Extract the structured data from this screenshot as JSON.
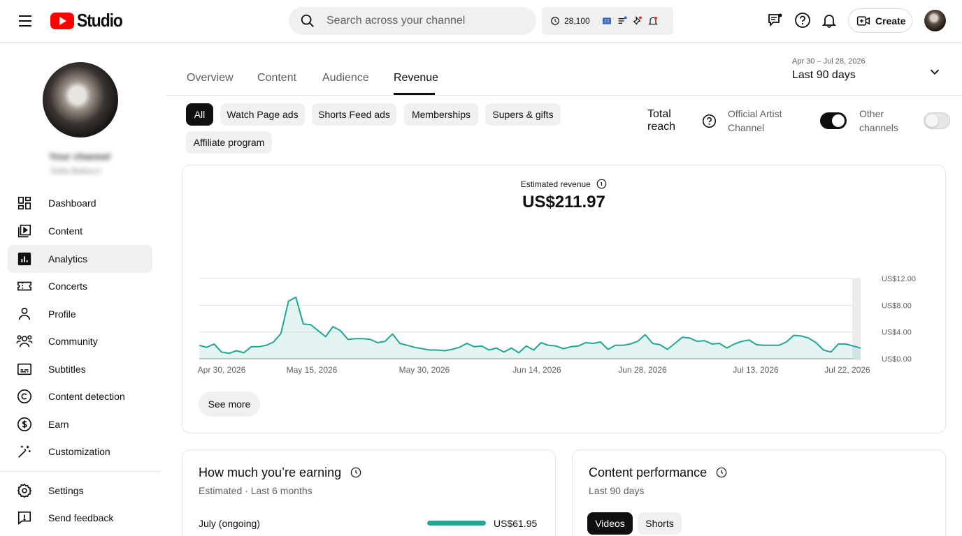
{
  "app": {
    "logo_text": "Studio"
  },
  "search": {
    "placeholder": "Search across your channel"
  },
  "status": {
    "count": "28,100"
  },
  "header": {
    "create_label": "Create"
  },
  "sidebar": {
    "channel_title": "Your channel",
    "channel_name": "Sofia Bellucci",
    "items": [
      {
        "label": "Dashboard",
        "icon": "dashboard-icon"
      },
      {
        "label": "Content",
        "icon": "content-icon"
      },
      {
        "label": "Analytics",
        "icon": "analytics-icon",
        "active": true
      },
      {
        "label": "Concerts",
        "icon": "ticket-icon"
      },
      {
        "label": "Profile",
        "icon": "person-icon"
      },
      {
        "label": "Community",
        "icon": "community-icon"
      },
      {
        "label": "Subtitles",
        "icon": "subtitles-icon"
      },
      {
        "label": "Content detection",
        "icon": "copyright-icon"
      },
      {
        "label": "Earn",
        "icon": "dollar-icon"
      },
      {
        "label": "Customization",
        "icon": "magic-wand-icon"
      }
    ],
    "footer_items": [
      {
        "label": "Settings",
        "icon": "gear-icon"
      },
      {
        "label": "Send feedback",
        "icon": "feedback-icon"
      }
    ]
  },
  "tabs": [
    "Overview",
    "Content",
    "Audience",
    "Revenue"
  ],
  "active_tab": "Revenue",
  "date_range": {
    "label": "Apr 30 – Jul 28, 2026",
    "value": "Last 90 days"
  },
  "filters": [
    "All",
    "Watch Page ads",
    "Shorts Feed ads",
    "Memberships",
    "Supers & gifts",
    "Affiliate program"
  ],
  "active_filter": "All",
  "reach": {
    "title": "Total reach",
    "official_label": "Official Artist Channel",
    "official_on": true,
    "other_label": "Other channels",
    "other_on": false
  },
  "revenue": {
    "label": "Estimated revenue",
    "value": "US$211.97",
    "see_more": "See more"
  },
  "chart_data": {
    "type": "area",
    "title": "",
    "xlabel": "",
    "ylabel": "",
    "x_tick_labels": [
      "Apr 30, 2026",
      "May 15, 2026",
      "May 30, 2026",
      "Jun 14, 2026",
      "Jun 28, 2026",
      "Jul 13, 2026",
      "Jul 22, 2026"
    ],
    "y_tick_labels": [
      "US$12.00",
      "US$8.00",
      "US$4.00",
      "US$0.00"
    ],
    "ylim": [
      0,
      12
    ],
    "grid": true,
    "color": "#21a696",
    "series": [
      {
        "values": [
          2.0,
          1.7,
          2.2,
          1.0,
          0.8,
          1.2,
          0.9,
          1.8,
          1.8,
          2.0,
          2.5,
          3.8,
          8.6,
          9.2,
          5.2,
          5.1,
          4.2,
          3.3,
          4.8,
          4.2,
          2.9,
          3.0,
          3.0,
          2.9,
          2.4,
          2.6,
          3.7,
          2.3,
          2.0,
          1.7,
          1.5,
          1.3,
          1.3,
          1.2,
          1.4,
          1.7,
          2.3,
          1.8,
          1.9,
          1.3,
          1.6,
          1.0,
          1.6,
          0.9,
          1.9,
          1.3,
          2.4,
          2.0,
          1.9,
          1.5,
          1.8,
          1.9,
          2.4,
          2.3,
          2.5,
          1.4,
          2.0,
          2.0,
          2.2,
          2.6,
          3.6,
          2.3,
          2.1,
          1.4,
          2.3,
          3.2,
          3.1,
          2.6,
          2.7,
          2.2,
          2.3,
          1.6,
          2.2,
          2.6,
          2.8,
          2.1,
          2.0,
          2.0,
          2.0,
          2.5,
          3.5,
          3.4,
          3.1,
          2.4,
          1.3,
          1.0,
          2.2,
          2.2,
          1.9,
          1.6
        ]
      }
    ]
  },
  "earning": {
    "title": "How much you’re earning",
    "subtitle": "Estimated · Last 6 months",
    "rows": [
      {
        "month": "July (ongoing)",
        "amount": "US$61.95",
        "fraction": 1.0
      }
    ]
  },
  "performance": {
    "title": "Content performance",
    "subtitle": "Last 90 days",
    "tabs": [
      "Videos",
      "Shorts"
    ],
    "active_tab": "Videos"
  }
}
